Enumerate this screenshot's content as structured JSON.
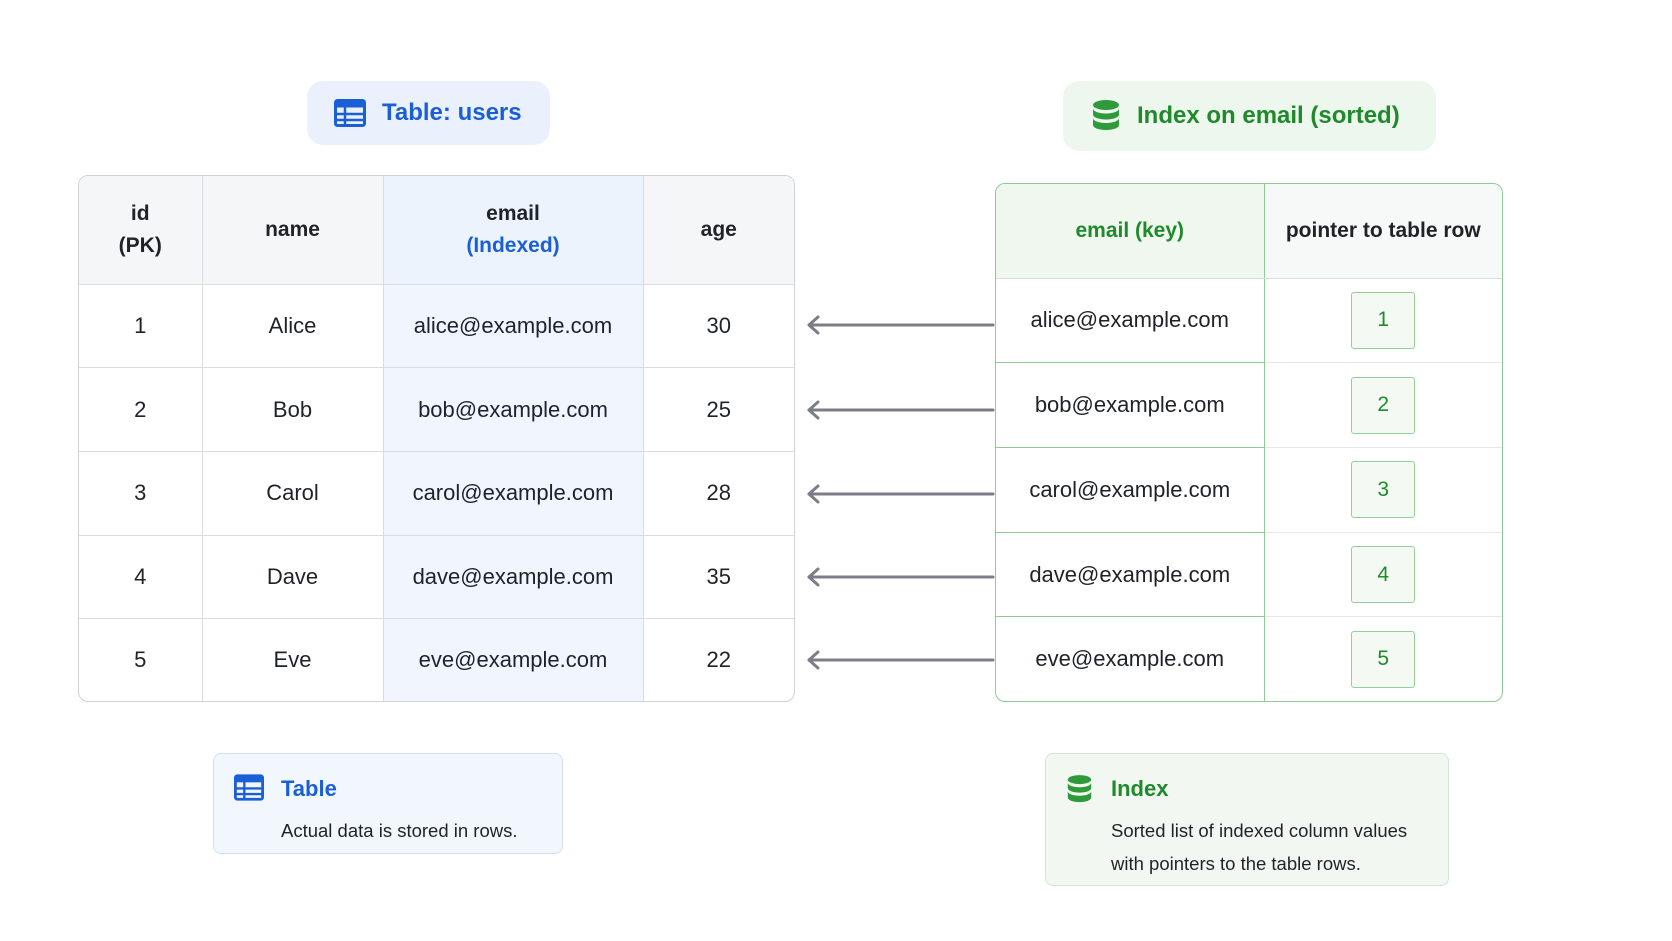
{
  "table_section": {
    "title": "Table: users",
    "headers": {
      "id_line1": "id",
      "id_line2": "(PK)",
      "name": "name",
      "email_line1": "email",
      "email_line2": "(Indexed)",
      "age": "age"
    },
    "rows": [
      {
        "id": "1",
        "name": "Alice",
        "email": "alice@example.com",
        "age": "30"
      },
      {
        "id": "2",
        "name": "Bob",
        "email": "bob@example.com",
        "age": "25"
      },
      {
        "id": "3",
        "name": "Carol",
        "email": "carol@example.com",
        "age": "28"
      },
      {
        "id": "4",
        "name": "Dave",
        "email": "dave@example.com",
        "age": "35"
      },
      {
        "id": "5",
        "name": "Eve",
        "email": "eve@example.com",
        "age": "22"
      }
    ]
  },
  "index_section": {
    "title": "Index on email (sorted)",
    "headers": {
      "key": "email (key)",
      "pointer": "pointer to table row"
    },
    "rows": [
      {
        "key": "alice@example.com",
        "pointer": "1"
      },
      {
        "key": "bob@example.com",
        "pointer": "2"
      },
      {
        "key": "carol@example.com",
        "pointer": "3"
      },
      {
        "key": "dave@example.com",
        "pointer": "4"
      },
      {
        "key": "eve@example.com",
        "pointer": "5"
      }
    ]
  },
  "legend": {
    "table": {
      "title": "Table",
      "description": "Actual data is stored in rows."
    },
    "index": {
      "title": "Index",
      "description": "Sorted list of indexed column values with pointers to the table rows."
    }
  },
  "icons": {
    "table": "table-grid-icon",
    "index": "database-icon",
    "arrow": "arrow-left-icon"
  },
  "colors": {
    "blue_accent": "#1a5fd6",
    "green_accent": "#1f8a2c",
    "arrow": "#7b7f85"
  }
}
